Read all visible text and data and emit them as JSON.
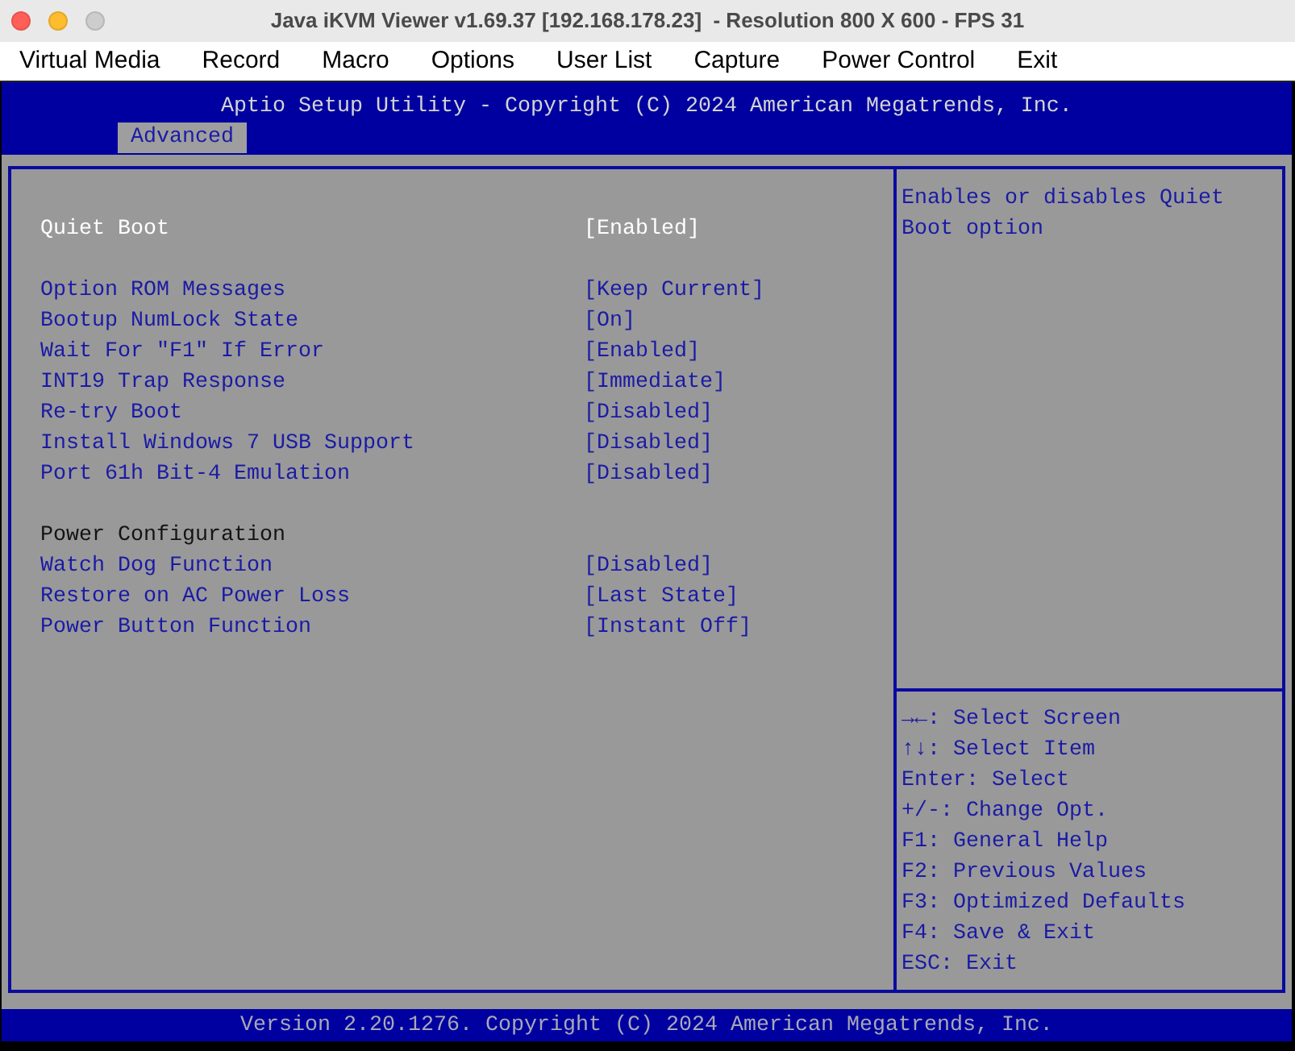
{
  "window": {
    "title": "Java iKVM Viewer v1.69.37 [192.168.178.23]  - Resolution 800 X 600 - FPS 31",
    "buttons": [
      {
        "kind": "close",
        "disabled": false
      },
      {
        "kind": "minimize",
        "disabled": false
      },
      {
        "kind": "zoom",
        "disabled": true
      }
    ]
  },
  "menu_bar": [
    "Virtual Media",
    "Record",
    "Macro",
    "Options",
    "User List",
    "Capture",
    "Power Control",
    "Exit"
  ],
  "bios": {
    "header": "Aptio Setup Utility - Copyright (C) 2024 American Megatrends, Inc.",
    "tabs": [
      {
        "label": "Advanced",
        "selected": true
      }
    ],
    "sections": [
      {
        "items": [
          {
            "label": "Quiet Boot",
            "value": "[Enabled]",
            "selected": true
          }
        ]
      },
      {
        "items": [
          {
            "label": "Option ROM Messages",
            "value": "[Keep Current]",
            "selected": false
          },
          {
            "label": "Bootup NumLock State",
            "value": "[On]",
            "selected": false
          },
          {
            "label": "Wait For \"F1\" If Error",
            "value": "[Enabled]",
            "selected": false
          },
          {
            "label": "INT19 Trap Response",
            "value": "[Immediate]",
            "selected": false
          },
          {
            "label": "Re-try Boot",
            "value": "[Disabled]",
            "selected": false
          },
          {
            "label": "Install Windows 7 USB Support",
            "value": "[Disabled]",
            "selected": false
          },
          {
            "label": "Port 61h Bit-4 Emulation",
            "value": "[Disabled]",
            "selected": false
          }
        ]
      },
      {
        "heading": "Power Configuration",
        "items": [
          {
            "label": "Watch Dog Function",
            "value": "[Disabled]",
            "selected": false
          },
          {
            "label": "Restore on AC Power Loss",
            "value": "[Last State]",
            "selected": false
          },
          {
            "label": "Power Button Function",
            "value": "[Instant Off]",
            "selected": false
          }
        ]
      }
    ],
    "help_text": "Enables or disables Quiet Boot option",
    "key_hints": [
      "**→←**: Select Screen",
      "**↑↓**: Select Item",
      "Enter: Select",
      "+/-: Change Opt.",
      "F1: General Help",
      "F2: Previous Values",
      "F3: Optimized Defaults",
      "F4: Save & Exit",
      "ESC: Exit"
    ],
    "footer": "Version 2.20.1276. Copyright (C) 2024 American Megatrends, Inc."
  }
}
